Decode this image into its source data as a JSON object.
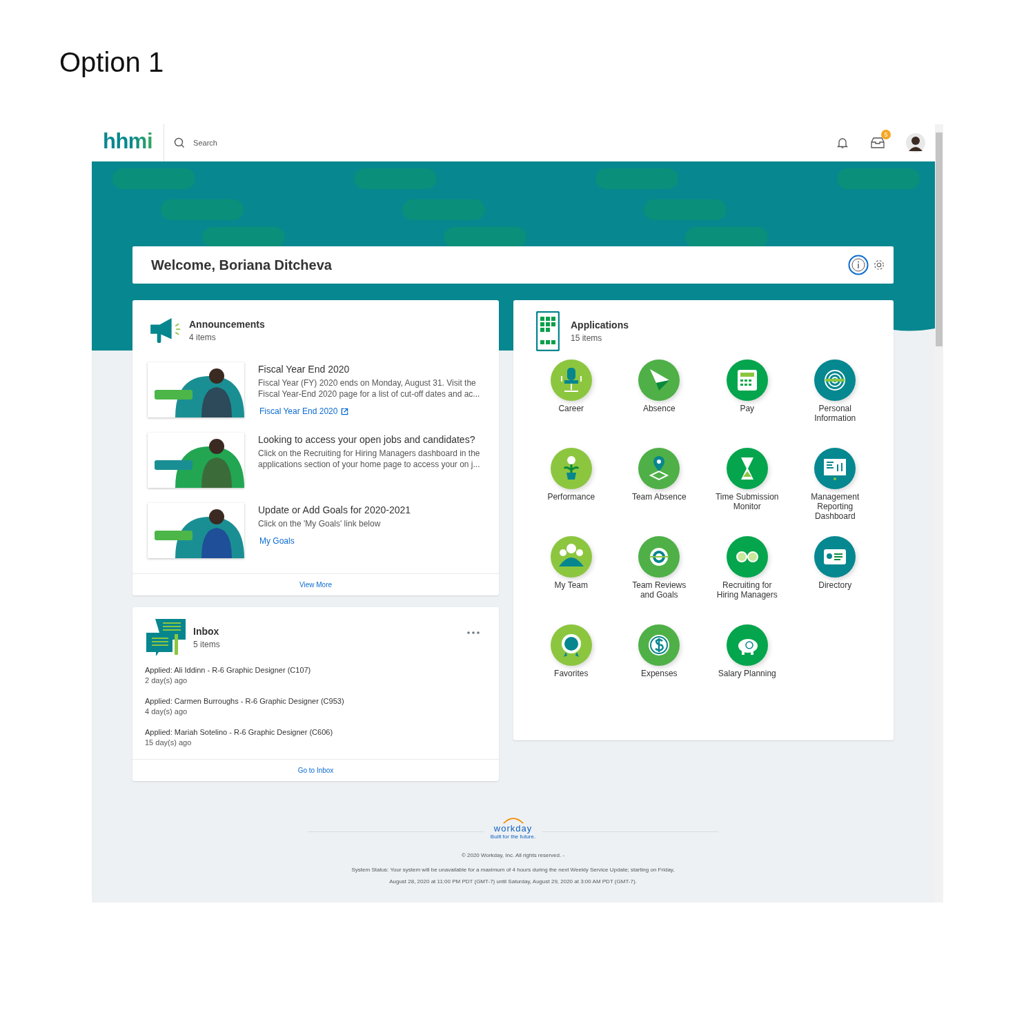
{
  "slide_title": "Option 1",
  "header": {
    "logo": "hhmi",
    "search": {
      "placeholder": "Search"
    },
    "inbox_badge": "5"
  },
  "welcome": {
    "title": "Welcome, Boriana Ditcheva"
  },
  "announcements": {
    "title": "Announcements",
    "count": "4 items",
    "footer_link": "View More",
    "items": [
      {
        "title": "Fiscal Year End 2020",
        "body": "Fiscal Year (FY) 2020 ends on Monday, August 31.  Visit the Fiscal Year-End 2020 page for a list of cut-off dates and ac...",
        "link": "Fiscal Year End 2020",
        "external": true
      },
      {
        "title": "Looking to access your open jobs and candidates?",
        "body": "Click on the Recruiting for Hiring Managers dashboard in the applications section of your home page to access your on j..."
      },
      {
        "title": "Update or Add Goals for 2020-2021",
        "body": "Click on the 'My Goals' link below",
        "link": "My Goals",
        "external": false
      }
    ]
  },
  "inbox": {
    "title": "Inbox",
    "count": "5 items",
    "footer_link": "Go to Inbox",
    "items": [
      {
        "text": "Applied: Ali Iddinn - R-6 Graphic Designer (C107)",
        "age": "2 day(s) ago"
      },
      {
        "text": "Applied: Carmen Burroughs - R-6 Graphic Designer (C953)",
        "age": "4 day(s) ago"
      },
      {
        "text": "Applied: Mariah Sotelino - R-6 Graphic Designer (C606)",
        "age": "15 day(s) ago"
      }
    ]
  },
  "applications": {
    "title": "Applications",
    "count": "15 items",
    "apps": [
      {
        "label": "Career",
        "color": "#8cc63f"
      },
      {
        "label": "Absence",
        "color": "#4fb047"
      },
      {
        "label": "Pay",
        "color": "#04a54d"
      },
      {
        "label": "Personal\nInformation",
        "color": "#058890"
      },
      {
        "label": "Performance",
        "color": "#8cc63f"
      },
      {
        "label": "Team Absence",
        "color": "#4fb047"
      },
      {
        "label": "Time Submission\nMonitor",
        "color": "#04a54d"
      },
      {
        "label": "Management\nReporting\nDashboard",
        "color": "#058890"
      },
      {
        "label": "My Team",
        "color": "#8cc63f"
      },
      {
        "label": "Team Reviews\nand Goals",
        "color": "#4fb047"
      },
      {
        "label": "Recruiting for\nHiring Managers",
        "color": "#04a54d"
      },
      {
        "label": "Directory",
        "color": "#058890"
      },
      {
        "label": "Favorites",
        "color": "#8cc63f"
      },
      {
        "label": "Expenses",
        "color": "#4fb047"
      },
      {
        "label": "Salary Planning",
        "color": "#04a54d"
      }
    ]
  },
  "footer": {
    "logo": "workday",
    "tagline": "Built for the future.",
    "copyright": "© 2020 Workday, Inc. All rights reserved. -",
    "status": "System Status: Your system will be unavailable for a maximum of 4 hours during the next Weekly Service Update; starting on Friday, August 28, 2020 at 11:00 PM PDT (GMT-7) until Saturday, August 29, 2020 at 3:00 AM PDT (GMT-7)."
  }
}
